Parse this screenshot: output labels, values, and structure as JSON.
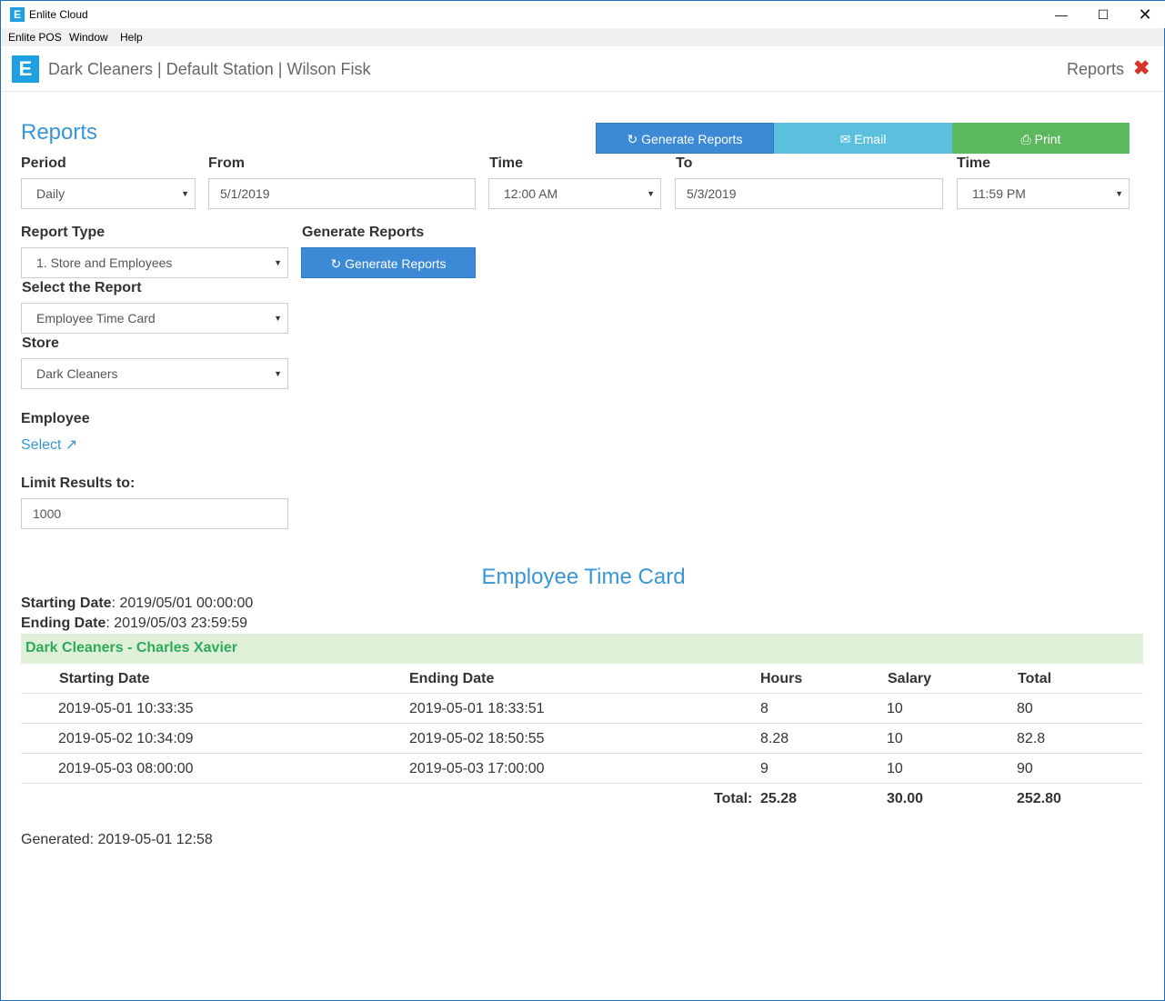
{
  "window": {
    "title": "Enlite Cloud",
    "icon": "E",
    "controls": {
      "minimize": "—",
      "maximize": "☐",
      "close": "✕"
    }
  },
  "menu": [
    "Enlite POS",
    "Window",
    "Help"
  ],
  "header": {
    "logo": "E",
    "breadcrumb": "Dark Cleaners | Default Station | Wilson Fisk",
    "section": "Reports",
    "close_icon": "✖"
  },
  "page": {
    "heading": "Reports"
  },
  "toolbar": {
    "generate_label": "Generate Reports",
    "email_label": "Email",
    "print_label": "Print"
  },
  "form": {
    "period": {
      "label": "Period",
      "value": "Daily"
    },
    "from": {
      "label": "From",
      "value": "5/1/2019"
    },
    "from_time": {
      "label": "Time",
      "value": "12:00 AM"
    },
    "to": {
      "label": "To",
      "value": "5/3/2019"
    },
    "to_time": {
      "label": "Time",
      "value": "11:59 PM"
    },
    "report_type": {
      "label": "Report Type",
      "value": "1. Store and Employees"
    },
    "generate": {
      "label": "Generate Reports",
      "button": "Generate Reports"
    },
    "select_report": {
      "label": "Select the Report",
      "value": "Employee Time Card"
    },
    "store": {
      "label": "Store",
      "value": "Dark Cleaners"
    },
    "employee": {
      "label": "Employee",
      "link": "Select"
    },
    "limit": {
      "label": "Limit Results to:",
      "value": "1000"
    }
  },
  "report": {
    "title": "Employee Time Card",
    "starting_label": "Starting Date",
    "starting_value": ": 2019/05/01 00:00:00",
    "ending_label": "Ending Date",
    "ending_value": ": 2019/05/03 23:59:59",
    "group": "Dark Cleaners - Charles Xavier",
    "columns": [
      "Starting Date",
      "Ending Date",
      "Hours",
      "Salary",
      "Total"
    ],
    "rows": [
      [
        "2019-05-01 10:33:35",
        "2019-05-01 18:33:51",
        "8",
        "10",
        "80"
      ],
      [
        "2019-05-02 10:34:09",
        "2019-05-02 18:50:55",
        "8.28",
        "10",
        "82.8"
      ],
      [
        "2019-05-03 08:00:00",
        "2019-05-03 17:00:00",
        "9",
        "10",
        "90"
      ]
    ],
    "totals": {
      "label": "Total:",
      "hours": "25.28",
      "salary": "30.00",
      "total": "252.80"
    },
    "generated": "Generated: 2019-05-01 12:58"
  },
  "colors": {
    "accent": "#3a95d4",
    "primary_button": "#3c8ad6",
    "email_button": "#5bc0de",
    "print_button": "#5cb85c",
    "group_bg": "#dff0d8",
    "close_red": "#d9342b"
  }
}
